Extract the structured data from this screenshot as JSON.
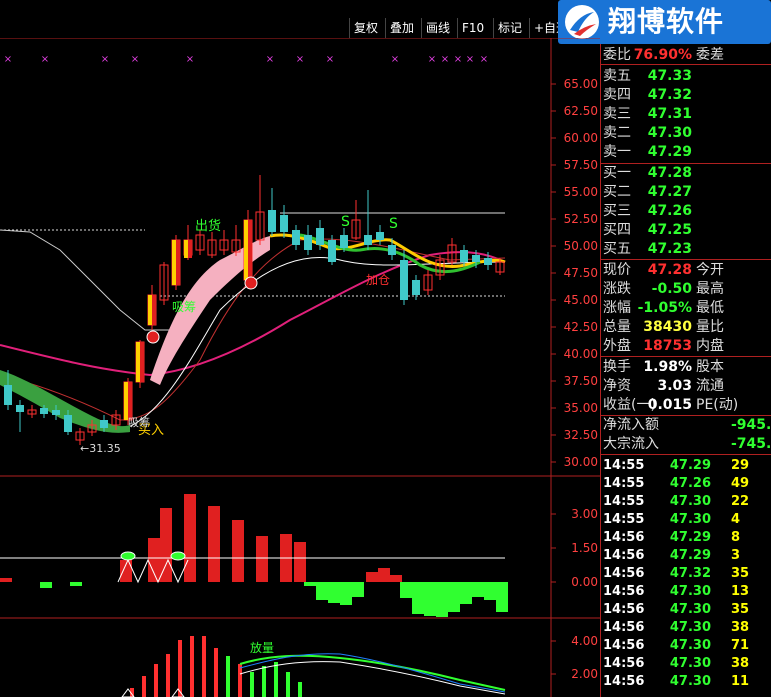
{
  "toolbar": {
    "buttons": [
      "复权",
      "叠加",
      "画线",
      "F10",
      "标记",
      "+自选"
    ]
  },
  "brand": {
    "name": "翔博软件",
    "logo_icon": "rocket-swoosh-icon",
    "color": "#1a74d6"
  },
  "price_axis": [
    "65.00",
    "62.50",
    "60.00",
    "57.50",
    "55.00",
    "52.50",
    "50.00",
    "47.50",
    "45.00",
    "42.50",
    "40.00",
    "37.50",
    "35.00",
    "32.50",
    "30.00"
  ],
  "macd_axis": [
    "3.00",
    "1.50",
    "0.00"
  ],
  "vol_axis": [
    "4.00",
    "2.00"
  ],
  "annotations": {
    "low_price": "←31.35",
    "sell_signal": "出货",
    "buy_signal": "买入",
    "buy_label2": "吸筹",
    "absorb_label": "吸筹",
    "add_label": "加仓",
    "s_mark": "S",
    "volume_label": "放量"
  },
  "order_book": {
    "wei_bi": {
      "label": "委比",
      "value": "76.90%",
      "extra": "委差"
    },
    "asks": [
      {
        "label": "卖五",
        "price": "47.33"
      },
      {
        "label": "卖四",
        "price": "47.32"
      },
      {
        "label": "卖三",
        "price": "47.31"
      },
      {
        "label": "卖二",
        "price": "47.30"
      },
      {
        "label": "卖一",
        "price": "47.29"
      }
    ],
    "bids": [
      {
        "label": "买一",
        "price": "47.28"
      },
      {
        "label": "买二",
        "price": "47.27"
      },
      {
        "label": "买三",
        "price": "47.26"
      },
      {
        "label": "买四",
        "price": "47.25"
      },
      {
        "label": "买五",
        "price": "47.23"
      }
    ]
  },
  "quote": [
    {
      "label": "现价",
      "value": "47.28",
      "extra": "今开",
      "color": "#ff3030"
    },
    {
      "label": "涨跌",
      "value": "-0.50",
      "extra": "最高",
      "color": "#30ff30"
    },
    {
      "label": "涨幅",
      "value": "-1.05%",
      "extra": "最低",
      "color": "#30ff30"
    },
    {
      "label": "总量",
      "value": "38430",
      "extra": "量比",
      "color": "#ffff40"
    },
    {
      "label": "外盘",
      "value": "18753",
      "extra": "内盘",
      "color": "#ff3030"
    }
  ],
  "stats": [
    {
      "label": "换手",
      "value": "1.98%",
      "extra": "股本",
      "color": "#fff"
    },
    {
      "label": "净资",
      "value": "3.03",
      "extra": "流通",
      "color": "#fff"
    },
    {
      "label": "收益(一)",
      "value": "0.015",
      "extra": "PE(动)",
      "color": "#fff"
    }
  ],
  "flows": [
    {
      "label": "净流入额",
      "value": "-945.0"
    },
    {
      "label": "大宗流入",
      "value": "-745.4"
    }
  ],
  "ticks": [
    {
      "time": "14:55",
      "price": "47.29",
      "vol": "29"
    },
    {
      "time": "14:55",
      "price": "47.26",
      "vol": "49"
    },
    {
      "time": "14:55",
      "price": "47.30",
      "vol": "22"
    },
    {
      "time": "14:55",
      "price": "47.30",
      "vol": "4"
    },
    {
      "time": "14:56",
      "price": "47.29",
      "vol": "8"
    },
    {
      "time": "14:56",
      "price": "47.29",
      "vol": "3"
    },
    {
      "time": "14:56",
      "price": "47.32",
      "vol": "35"
    },
    {
      "time": "14:56",
      "price": "47.30",
      "vol": "13"
    },
    {
      "time": "14:56",
      "price": "47.30",
      "vol": "35"
    },
    {
      "time": "14:56",
      "price": "47.30",
      "vol": "38"
    },
    {
      "time": "14:56",
      "price": "47.30",
      "vol": "71"
    },
    {
      "time": "14:56",
      "price": "47.30",
      "vol": "38"
    },
    {
      "time": "14:56",
      "price": "47.30",
      "vol": "11"
    }
  ],
  "colors": {
    "up": "#ff3030",
    "down": "#30ff30",
    "neutral": "#ffffff",
    "ask_price": "#30ff30",
    "bid_price": "#30ff30",
    "border": "#b02020"
  }
}
